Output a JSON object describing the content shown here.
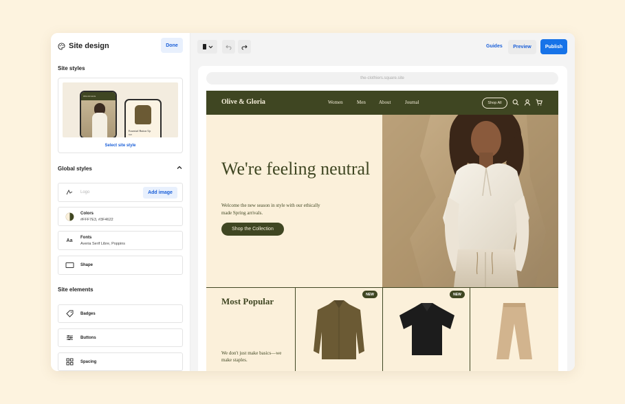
{
  "sidebar": {
    "title": "Site design",
    "done_label": "Done",
    "site_styles": {
      "heading": "Site styles",
      "select_link": "Select site style",
      "thumb_brand": "Olive & Gloria",
      "thumb_product": "Essential Button Up",
      "thumb_price": "$98"
    },
    "global_styles": {
      "heading": "Global styles",
      "logo_placeholder": "Logo",
      "add_image_label": "Add image",
      "colors_title": "Colors",
      "colors_value": "#FFF7E3, #3F4622",
      "fonts_title": "Fonts",
      "fonts_value": "Averia Serif Libre, Poppins",
      "shape_title": "Shape"
    },
    "site_elements": {
      "heading": "Site elements",
      "items": [
        {
          "label": "Badges",
          "icon": "tag-icon"
        },
        {
          "label": "Buttons",
          "icon": "sliders-icon"
        },
        {
          "label": "Spacing",
          "icon": "grid-icon"
        }
      ]
    }
  },
  "toolbar": {
    "device_icon": "mobile-device-icon",
    "undo_icon": "undo-icon",
    "redo_icon": "redo-icon",
    "guides_label": "Guides",
    "preview_label": "Preview",
    "publish_label": "Publish"
  },
  "preview": {
    "url": "the-clothiers.square.site",
    "site": {
      "brand": "Olive & Gloria",
      "nav": [
        "Women",
        "Men",
        "About",
        "Journal"
      ],
      "shop_all": "Shop All",
      "hero_title": "We're feeling neutral",
      "hero_subtitle": "Welcome the new season in style with our ethically made Spring arrivals.",
      "hero_cta": "Shop the Collection",
      "popular_title": "Most Popular",
      "popular_subtitle": "We don't just make basics—we make staples.",
      "products": [
        {
          "badge": "NEW",
          "item": "olive-button-up-shirt"
        },
        {
          "badge": "NEW",
          "item": "black-polo-shirt"
        },
        {
          "badge": "",
          "item": "beige-trousers"
        }
      ]
    }
  },
  "colors": {
    "background": "#fdf3df",
    "olive": "#3f4622",
    "cream": "#fbf0da",
    "accent_blue": "#1a5fd8"
  }
}
